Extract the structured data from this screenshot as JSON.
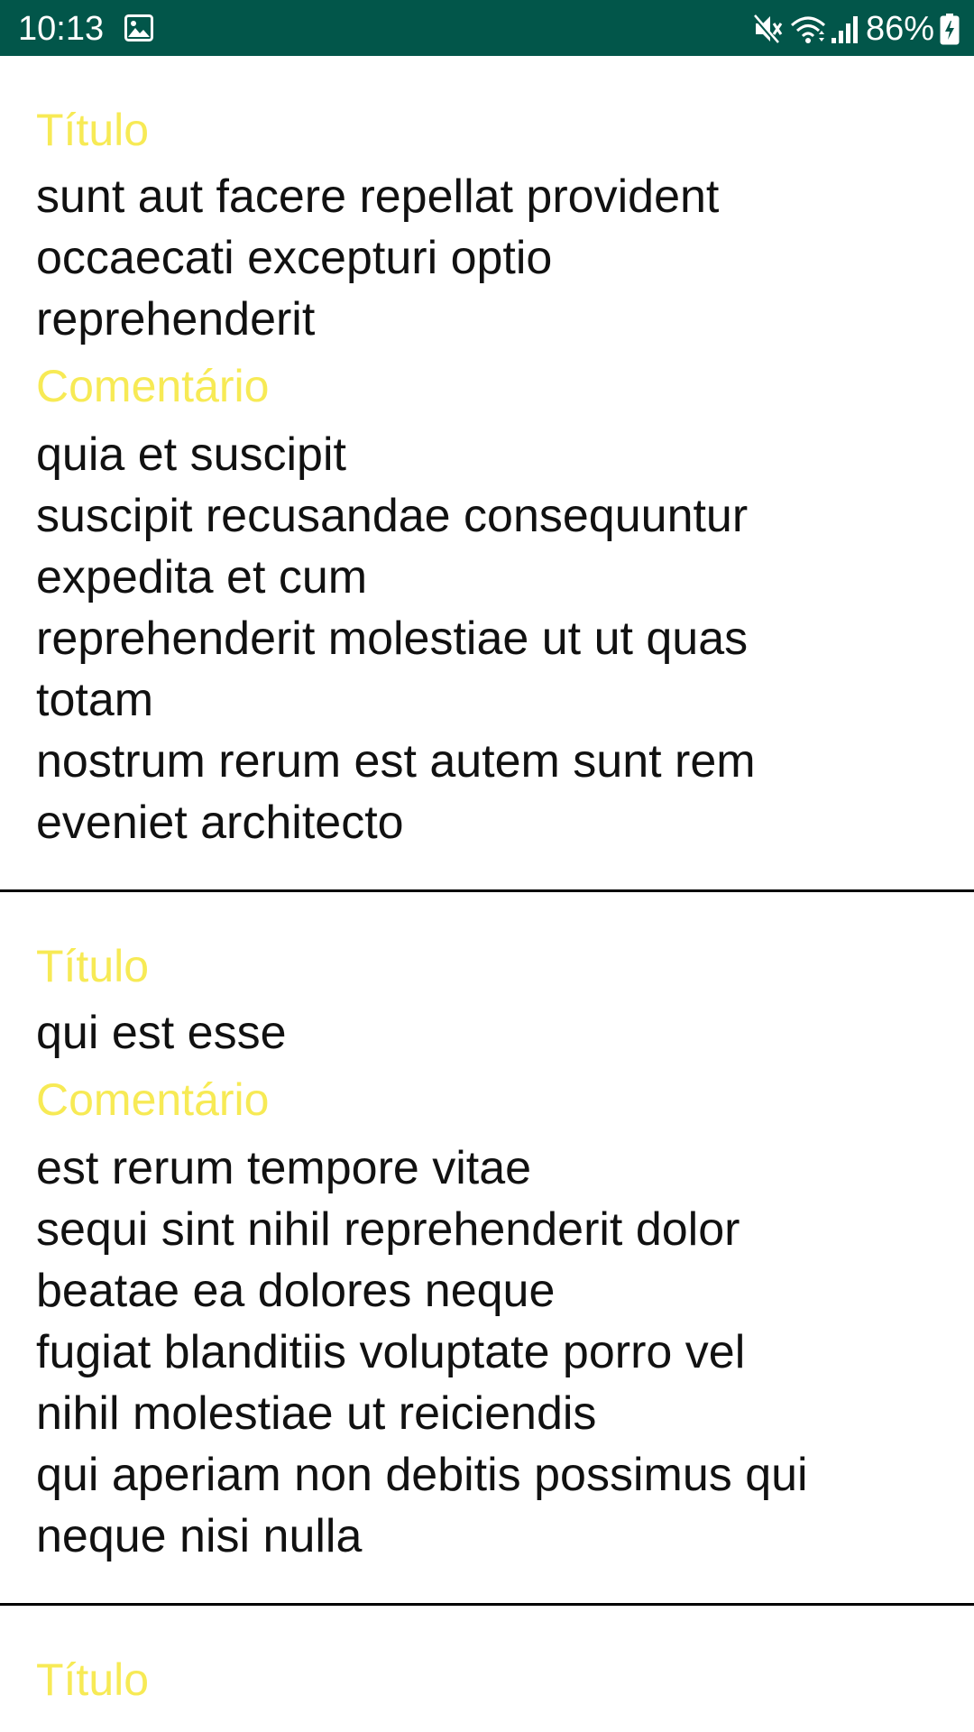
{
  "status_bar": {
    "time": "10:13",
    "battery_text": "86%",
    "background_color": "#02564a",
    "icons": [
      "gallery-icon",
      "mute-icon",
      "wifi-icon",
      "signal-icon",
      "battery-icon"
    ]
  },
  "colors": {
    "label": "#f7ea55",
    "text": "#111111",
    "divider": "#000000"
  },
  "posts": [
    {
      "title_label": "Título",
      "title": "sunt aut facere repellat provident\noccaecati excepturi optio\nreprehenderit",
      "body_label": "Comentário",
      "body": "quia et suscipit\nsuscipit recusandae consequuntur\nexpedita et cum\nreprehenderit molestiae ut ut quas\ntotam\nnostrum rerum est autem sunt rem\neveniet architecto"
    },
    {
      "title_label": "Título",
      "title": "qui est esse",
      "body_label": "Comentário",
      "body": "est rerum tempore vitae\nsequi sint nihil reprehenderit dolor\nbeatae ea dolores neque\nfugiat blanditiis voluptate porro vel\nnihil molestiae ut reiciendis\nqui aperiam non debitis possimus qui\nneque nisi nulla"
    },
    {
      "title_label": "Título"
    }
  ]
}
